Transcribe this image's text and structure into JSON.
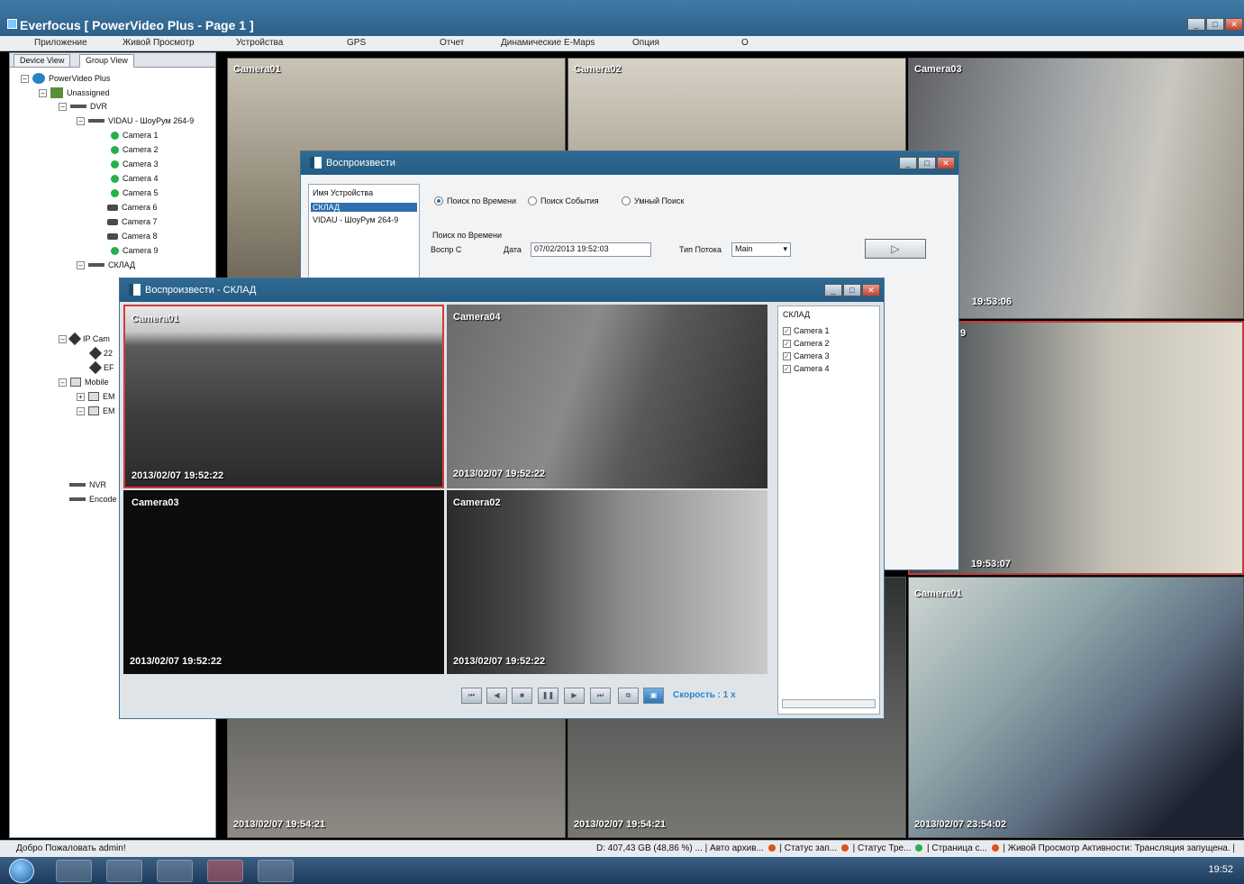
{
  "window": {
    "title": "Everfocus  [ PowerVideo Plus - Page 1 ]"
  },
  "menu": [
    "Приложение",
    "Живой Просмотр",
    "Устройства",
    "GPS",
    "Отчет",
    "Динамические E-Maps",
    "Опция",
    "О"
  ],
  "left_panel": {
    "tabs": [
      "Device View",
      "Group View"
    ],
    "tree": {
      "root": "PowerVideo Plus",
      "unassigned": "Unassigned",
      "dvr": "DVR",
      "vidau": "VIDAU - ШоуРум 264-9",
      "cameras": [
        "Camera 1",
        "Camera 2",
        "Camera 3",
        "Camera 4",
        "Camera 5",
        "Camera 6",
        "Camera 7",
        "Camera 8",
        "Camera 9"
      ],
      "sklad": "СКЛАД",
      "ipcam": "IP Cam",
      "ip1": "22",
      "ip2": "EF",
      "mobile": "Mobile",
      "m1": "EM",
      "m2": "EM",
      "nvr": "NVR",
      "encoder": "Encode"
    }
  },
  "main_grid": {
    "tiles": [
      {
        "label": "Camera01",
        "stamp": ""
      },
      {
        "label": "Camera02",
        "stamp": ""
      },
      {
        "label": "Camera03",
        "stamp": "19:53:06"
      },
      {
        "label": "9",
        "stamp": "19:53:07"
      },
      {
        "label": "",
        "stamp": "2013/02/07  19:54:21"
      },
      {
        "label": "",
        "stamp": "2013/02/07  19:54:21"
      },
      {
        "label": "Camera01",
        "stamp": "2013/02/07  23:54:02"
      }
    ]
  },
  "playback_dialog": {
    "title": "Воспроизвести",
    "device_header": "Имя Устройства",
    "devices": [
      "СКЛАД",
      "VIDAU - ШоуРум 264-9"
    ],
    "search_modes": [
      "Поиск по Времени",
      "Поиск События",
      "Умный Поиск"
    ],
    "time_search_label": "Поиск по Времени",
    "play_from_label": "Воспр С",
    "date_label": "Дата",
    "date_value": "07/02/2013 19:52:03",
    "stream_type_label": "Тип Потока",
    "stream_type_value": "Main",
    "play_button": "▷"
  },
  "playback_window": {
    "title": "Воспроизвести - СКЛАД",
    "tiles": [
      {
        "label": "Camera01",
        "stamp": "2013/02/07  19:52:22"
      },
      {
        "label": "Camera04",
        "stamp": "2013/02/07  19:52:22"
      },
      {
        "label": "Camera03",
        "stamp": "2013/02/07  19:52:22"
      },
      {
        "label": "Camera02",
        "stamp": "2013/02/07  19:52:22"
      }
    ],
    "group": "СКЛАД",
    "cameras": [
      "Camera 1",
      "Camera 2",
      "Camera 3",
      "Camera 4"
    ],
    "controls": [
      "⏮",
      "◀",
      "■",
      "❚❚",
      "▶",
      "⏭",
      "⧉",
      "▣"
    ],
    "speed": "Скорость : 1 x"
  },
  "status_bar": {
    "welcome": "Добро Пожаловать admin!",
    "disk": "D: 407,43 GB (48,86 %) ... | Авто архив...",
    "s1": "| Статус зап...",
    "s2": "| Статус Тре...",
    "s3": "| Страница с...",
    "s4": "| Живой Просмотр Активности: Трансляция запущена. |"
  },
  "taskbar": {
    "clock": "19:52"
  },
  "colors": {
    "title": "#2d6088",
    "accent": "#2f6fb0",
    "ok": "#24b14a",
    "warn": "#d9541e",
    "speed": "#2c84c7"
  }
}
